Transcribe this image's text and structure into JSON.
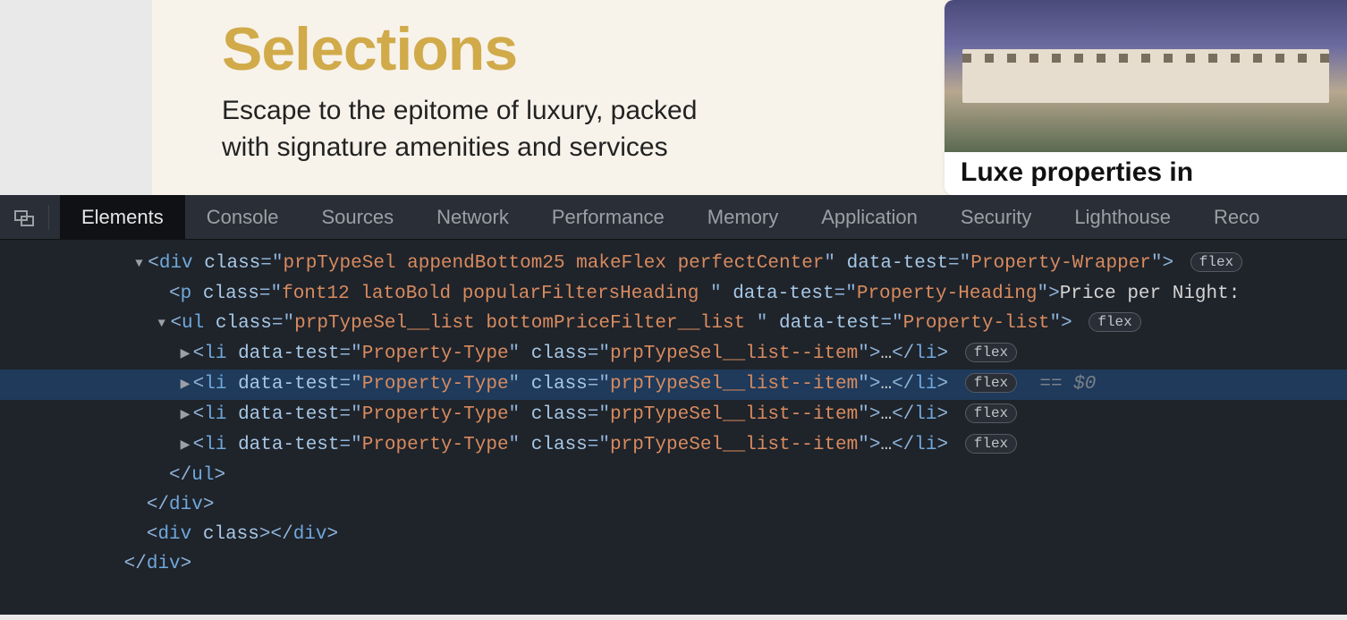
{
  "page": {
    "heading": "Selections",
    "subtitle_line1": "Escape to the epitome of luxury, packed",
    "subtitle_line2": "with signature amenities and services",
    "card_caption": "Luxe properties in"
  },
  "devtools": {
    "tabs": [
      "Elements",
      "Console",
      "Sources",
      "Network",
      "Performance",
      "Memory",
      "Application",
      "Security",
      "Lighthouse",
      "Reco"
    ],
    "active_tab_index": 0,
    "flex_badge": "flex",
    "selected_ref": "== $0",
    "dom": {
      "wrapper": {
        "tag": "div",
        "class": "prpTypeSel appendBottom25 makeFlex perfectCenter",
        "data_test": "Property-Wrapper"
      },
      "heading": {
        "tag": "p",
        "class": "font12 latoBold popularFiltersHeading ",
        "data_test": "Property-Heading",
        "text": "Price per Night:"
      },
      "list": {
        "tag": "ul",
        "class": "prpTypeSel__list bottomPriceFilter__list ",
        "data_test": "Property-list"
      },
      "item": {
        "tag": "li",
        "data_test": "Property-Type",
        "class": "prpTypeSel__list--item",
        "ellipsis": "…"
      },
      "item_count": 4,
      "close_ul": "</ul>",
      "close_div": "</div>",
      "empty_div": "<div class></div>",
      "close_outer": "</div>"
    }
  }
}
